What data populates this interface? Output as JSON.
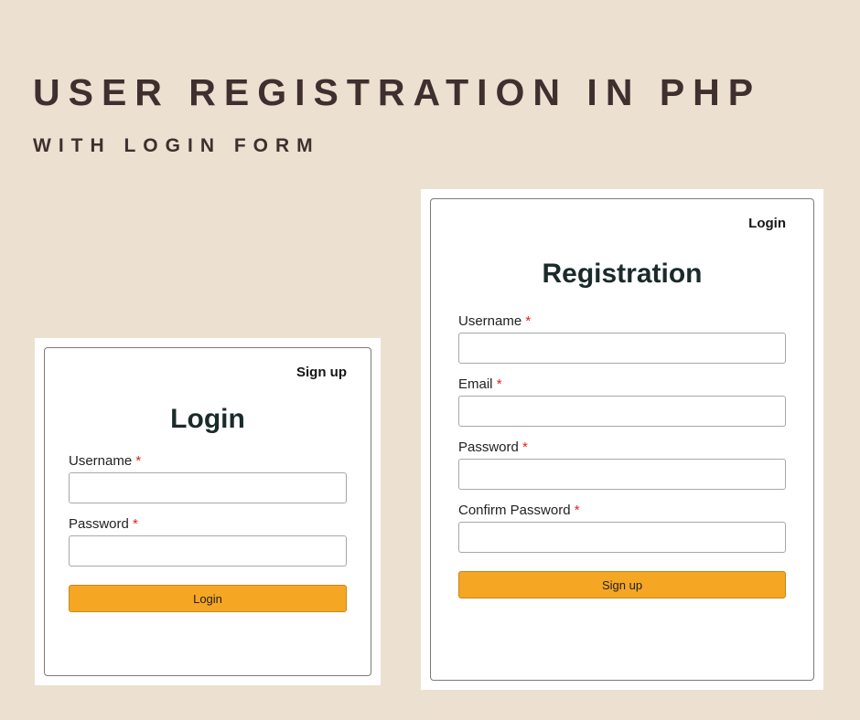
{
  "heading": "USER REGISTRATION IN PHP",
  "subheading": "WITH LOGIN FORM",
  "required_marker": "*",
  "login": {
    "toplink": "Sign up",
    "title": "Login",
    "fields": {
      "username": {
        "label": "Username",
        "value": ""
      },
      "password": {
        "label": "Password",
        "value": ""
      }
    },
    "submit": "Login"
  },
  "registration": {
    "toplink": "Login",
    "title": "Registration",
    "fields": {
      "username": {
        "label": "Username",
        "value": ""
      },
      "email": {
        "label": "Email",
        "value": ""
      },
      "password": {
        "label": "Password",
        "value": ""
      },
      "confirm_password": {
        "label": "Confirm Password",
        "value": ""
      }
    },
    "submit": "Sign up"
  }
}
